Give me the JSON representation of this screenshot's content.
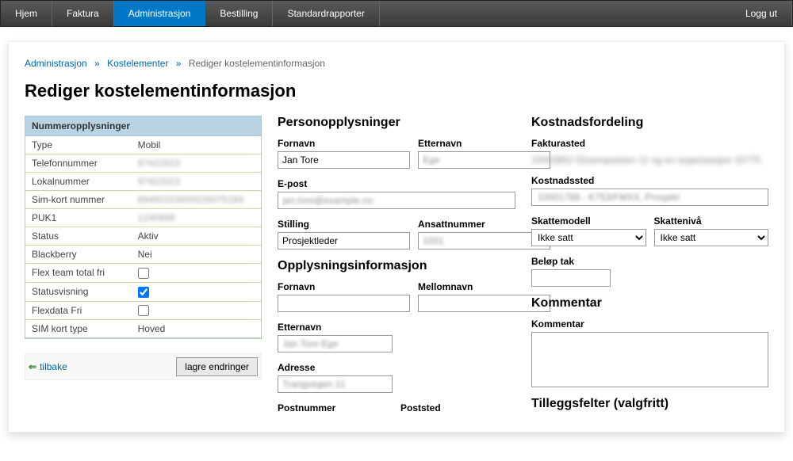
{
  "nav": {
    "hjem": "Hjem",
    "faktura": "Faktura",
    "administrasjon": "Administrasjon",
    "bestilling": "Bestilling",
    "standardrapporter": "Standardrapporter",
    "logg_ut": "Logg ut"
  },
  "breadcrumb": {
    "administrasjon": "Administrasjon",
    "kostelementer": "Kostelementer",
    "current": "Rediger kostelementinformasjon"
  },
  "page_title": "Rediger kostelementinformasjon",
  "info_panel": {
    "header": "Nummeropplysninger",
    "rows": {
      "type_label": "Type",
      "type_value": "Mobil",
      "telefonnummer_label": "Telefonnummer",
      "telefonnummer_value": "97422023",
      "lokalnummer_label": "Lokalnummer",
      "lokalnummer_value": "97422023",
      "simkort_label": "Sim-kort nummer",
      "simkort_value": "89450153000026075184",
      "puk1_label": "PUK1",
      "puk1_value": "1240998",
      "status_label": "Status",
      "status_value": "Aktiv",
      "blackberry_label": "Blackberry",
      "blackberry_value": "Nei",
      "flexteam_label": "Flex team total fri",
      "statusvisning_label": "Statusvisning",
      "flexdata_label": "Flexdata Fri",
      "simkorttype_label": "SIM kort type",
      "simkorttype_value": "Hoved"
    }
  },
  "actions": {
    "tilbake": "tilbake",
    "lagre": "lagre endringer"
  },
  "personopplysninger": {
    "heading": "Personopplysninger",
    "fornavn_label": "Fornavn",
    "fornavn_value": "Jan Tore",
    "etternavn_label": "Etternavn",
    "etternavn_value": "Ege",
    "epost_label": "E-post",
    "epost_value": "jan.tore@example.no",
    "stilling_label": "Stilling",
    "stilling_value": "Prosjektleder",
    "ansattnummer_label": "Ansattnummer",
    "ansattnummer_value": "1001"
  },
  "opplysningsinformasjon": {
    "heading": "Opplysningsinformasjon",
    "fornavn_label": "Fornavn",
    "fornavn_value": "",
    "mellomnavn_label": "Mellomnavn",
    "mellomnavn_value": "",
    "etternavn_label": "Etternavn",
    "etternavn_value": "Jan Tore Ege",
    "adresse_label": "Adresse",
    "adresse_value": "Trangvegen 11",
    "postnummer_label": "Postnummer",
    "poststed_label": "Poststed"
  },
  "kostnadsfordeling": {
    "heading": "Kostnadsfordeling",
    "fakturasted_label": "Fakturasted",
    "fakturasted_text": "10003852 Eksempeleien 11 og en organisasjon 10775",
    "kostnadssted_label": "Kostnadssted",
    "kostnadssted_value": "10001788 - K753/FMXX, Prosjekt",
    "skattemodell_label": "Skattemodell",
    "skattemodell_value": "Ikke satt",
    "skatteniva_label": "Skattenivå",
    "skatteniva_value": "Ikke satt",
    "belop_tak_label": "Beløp tak",
    "belop_tak_value": ""
  },
  "kommentar": {
    "heading": "Kommentar",
    "kommentar_label": "Kommentar",
    "kommentar_value": ""
  },
  "tillegg": {
    "heading": "Tilleggsfelter (valgfritt)"
  }
}
